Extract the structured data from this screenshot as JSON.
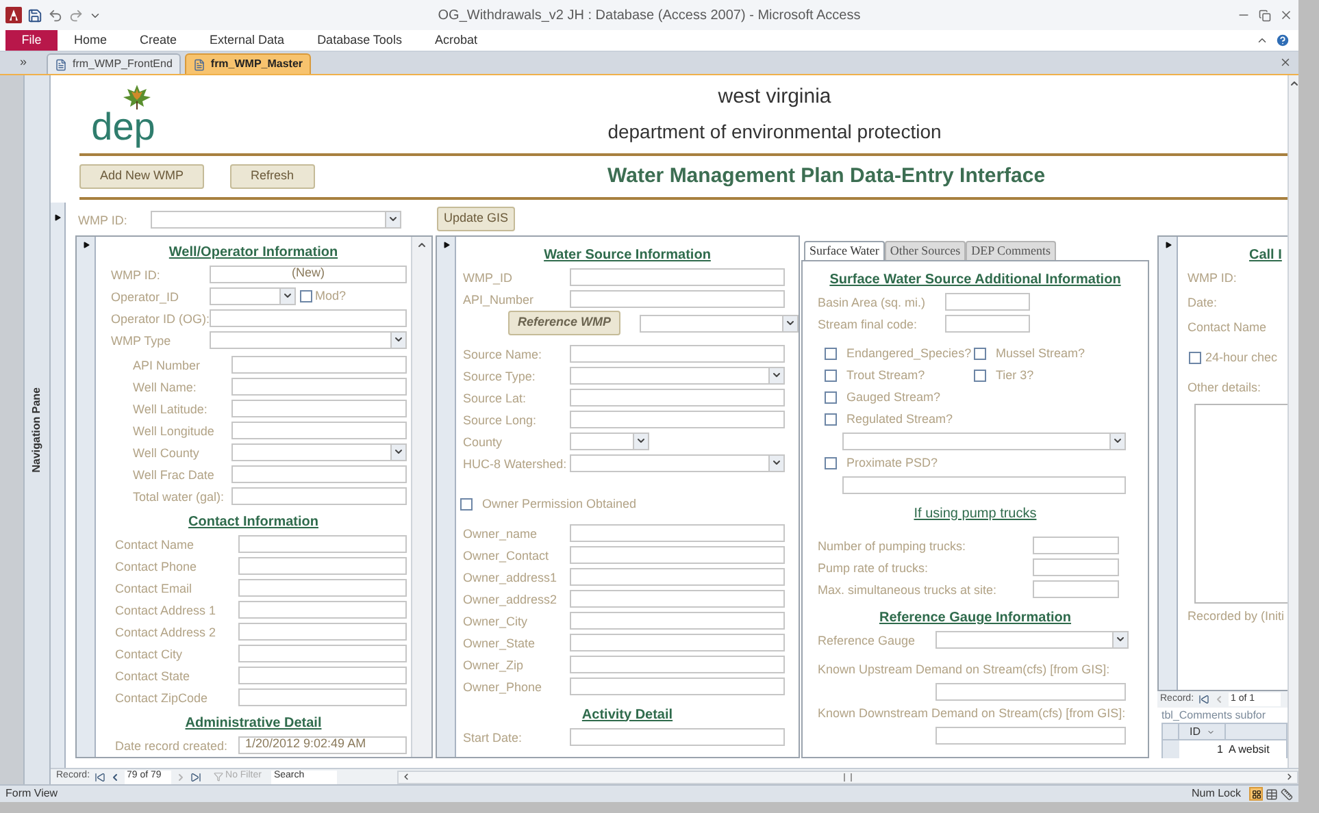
{
  "window": {
    "title": "OG_Withdrawals_v2 JH : Database (Access 2007)  -  Microsoft Access"
  },
  "ribbon_tabs": [
    {
      "label": "File",
      "kind": "file"
    },
    {
      "label": "Home",
      "kind": "tab"
    },
    {
      "label": "Create",
      "kind": "tab"
    },
    {
      "label": "External Data",
      "kind": "tab"
    },
    {
      "label": "Database Tools",
      "kind": "tab"
    },
    {
      "label": "Acrobat",
      "kind": "tab"
    }
  ],
  "shutter": "»",
  "document_tabs": [
    {
      "label": "frm_WMP_FrontEnd",
      "selected": false
    },
    {
      "label": "frm_WMP_Master",
      "selected": true
    }
  ],
  "navigation_pane": "Navigation Pane",
  "header": {
    "logo_text": "dep",
    "state": "west virginia",
    "agency": "department of environmental protection",
    "buttons": [
      "Add New WMP",
      "Refresh"
    ],
    "title": "Water Management Plan Data-Entry Interface"
  },
  "wmp_filter": {
    "label": "WMP ID:",
    "button": "Update GIS"
  },
  "well_panel": {
    "sections": [
      {
        "heading": "Well/Operator Information",
        "items": [
          {
            "kind": "autonumber",
            "label": "WMP ID:",
            "value": "(New)"
          },
          {
            "kind": "combo_check",
            "label": "Operator_ID",
            "check_label": "Mod?",
            "checked": false
          },
          {
            "kind": "text",
            "label": "Operator ID (OG):"
          },
          {
            "kind": "combo",
            "label": "WMP Type"
          }
        ]
      },
      {
        "items": [
          {
            "kind": "text",
            "label": "API Number"
          },
          {
            "kind": "text",
            "label": "Well Name:"
          },
          {
            "kind": "text",
            "label": "Well Latitude:"
          },
          {
            "kind": "text",
            "label": "Well Longitude"
          },
          {
            "kind": "combo",
            "label": "Well County"
          },
          {
            "kind": "text",
            "label": "Well Frac Date"
          },
          {
            "kind": "text",
            "label": "Total water (gal):"
          }
        ]
      },
      {
        "heading": "Contact Information",
        "items": [
          {
            "kind": "text",
            "label": "Contact Name"
          },
          {
            "kind": "text",
            "label": "Contact Phone"
          },
          {
            "kind": "text",
            "label": "Contact Email"
          },
          {
            "kind": "text",
            "label": "Contact Address 1"
          },
          {
            "kind": "text",
            "label": "Contact Address 2"
          },
          {
            "kind": "text",
            "label": "Contact City"
          },
          {
            "kind": "text",
            "label": "Contact State"
          },
          {
            "kind": "text",
            "label": "Contact ZipCode"
          }
        ]
      },
      {
        "heading": "Administrative Detail",
        "items": [
          {
            "kind": "text",
            "label": "Date record created:",
            "value": "1/20/2012 9:02:49 AM"
          }
        ]
      }
    ]
  },
  "source_panel": {
    "items": [
      {
        "kind": "heading",
        "text": "Water Source Information"
      },
      {
        "kind": "text",
        "label": "WMP_ID"
      },
      {
        "kind": "text",
        "label": "API_Number"
      },
      {
        "kind": "button_combo",
        "button": "Reference WMP"
      },
      {
        "kind": "text",
        "label": "Source Name:"
      },
      {
        "kind": "combo",
        "label": "Source Type:"
      },
      {
        "kind": "text",
        "label": "Source Lat:"
      },
      {
        "kind": "text",
        "label": "Source Long:"
      },
      {
        "kind": "short_combo",
        "label": "County"
      },
      {
        "kind": "combo",
        "label": "HUC-8 Watershed:"
      },
      {
        "kind": "check",
        "label": "Owner Permission Obtained",
        "checked": false
      },
      {
        "kind": "text",
        "label": "Owner_name"
      },
      {
        "kind": "text",
        "label": "Owner_Contact"
      },
      {
        "kind": "text",
        "label": "Owner_address1"
      },
      {
        "kind": "text",
        "label": "Owner_address2"
      },
      {
        "kind": "text",
        "label": "Owner_City"
      },
      {
        "kind": "text",
        "label": "Owner_State"
      },
      {
        "kind": "text",
        "label": "Owner_Zip"
      },
      {
        "kind": "text",
        "label": "Owner_Phone"
      },
      {
        "kind": "heading",
        "text": "Activity Detail"
      },
      {
        "kind": "text",
        "label": "Start Date:"
      }
    ]
  },
  "tab_panel": {
    "tabs": [
      {
        "label": "Surface Water",
        "selected": true
      },
      {
        "label": "Other Sources",
        "selected": false
      },
      {
        "label": "DEP Comments",
        "selected": false
      }
    ],
    "items": [
      {
        "kind": "heading",
        "text": "Surface Water Source Additional Information"
      },
      {
        "kind": "short_text",
        "label": "Basin Area (sq. mi.)"
      },
      {
        "kind": "short_text",
        "label": "Stream final code:"
      },
      {
        "kind": "check_row",
        "checks": [
          {
            "label": "Endangered_Species?",
            "checked": false
          },
          {
            "label": "Mussel Stream?",
            "checked": false
          }
        ]
      },
      {
        "kind": "check_row",
        "checks": [
          {
            "label": "Trout Stream?",
            "checked": false
          },
          {
            "label": "Tier 3?",
            "checked": false
          }
        ]
      },
      {
        "kind": "check",
        "label": "Gauged Stream?",
        "checked": false
      },
      {
        "kind": "check",
        "label": "Regulated Stream?",
        "checked": false
      },
      {
        "kind": "bare_combo"
      },
      {
        "kind": "check",
        "label": "Proximate PSD?",
        "checked": false
      },
      {
        "kind": "bare_text"
      },
      {
        "kind": "subheading",
        "text": "If using pump trucks"
      },
      {
        "kind": "right_text",
        "label": "Number of pumping trucks:"
      },
      {
        "kind": "right_text",
        "label": "Pump rate of trucks:"
      },
      {
        "kind": "right_text",
        "label": "Max. simultaneous trucks at site:"
      },
      {
        "kind": "heading",
        "text": "Reference Gauge Information"
      },
      {
        "kind": "gauge_combo",
        "label": "Reference Gauge"
      },
      {
        "kind": "stacked_text",
        "label": "Known Upstream Demand on Stream(cfs) [from GIS]:"
      },
      {
        "kind": "stacked_text",
        "label": "Known Downstream  Demand on Stream(cfs) [from GIS]:"
      }
    ]
  },
  "call_panel": {
    "items": [
      {
        "kind": "call_heading",
        "text": "Call I"
      },
      {
        "kind": "label",
        "label": "WMP ID:"
      },
      {
        "kind": "label",
        "label": "Date:"
      },
      {
        "kind": "label",
        "label": "Contact Name"
      },
      {
        "kind": "check",
        "label": "24-hour chec",
        "checked": false
      },
      {
        "kind": "label",
        "label": "Other details:"
      },
      {
        "kind": "memo"
      },
      {
        "kind": "label",
        "label": "Recorded by (Initi"
      }
    ],
    "record_nav": {
      "label": "Record:",
      "position": "1 of 1"
    },
    "subform_caption": "tbl_Comments subfor",
    "datasheet": {
      "columns": [
        "ID"
      ],
      "rows": [
        [
          "1",
          "A websit"
        ]
      ]
    }
  },
  "record_nav": {
    "label": "Record:",
    "position": "79 of 79",
    "filter": "No Filter",
    "placeholder": "Search"
  },
  "status_bar": {
    "left": "Form View",
    "right": "Num Lock"
  }
}
